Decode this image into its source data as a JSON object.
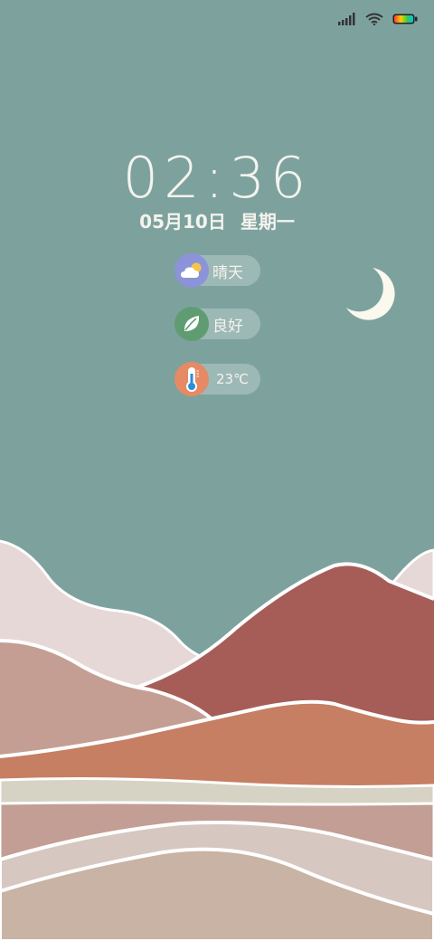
{
  "status_bar": {
    "icons": [
      "signal-icon",
      "wifi-icon",
      "battery-icon"
    ],
    "battery_colors": [
      "#ff3b30",
      "#ffcc00",
      "#34c759",
      "#00c7e6"
    ]
  },
  "lockscreen": {
    "time": "02:36",
    "date": "05月10日",
    "weekday": "星期一"
  },
  "widgets": [
    {
      "icon": "partly-cloudy-icon",
      "label": "晴天",
      "color": "#8c93d8"
    },
    {
      "icon": "leaf-icon",
      "label": "良好",
      "color": "#5f9c72"
    },
    {
      "icon": "thermometer-icon",
      "label": "23℃",
      "color": "#e58a64"
    }
  ],
  "wallpaper": {
    "moon_icon": "crescent-moon-icon",
    "colors": {
      "sky": "#7da29e",
      "pink_mountain": "#e6d8d7",
      "red_mountain": "#a65d58",
      "dusty_rose": "#c49e93",
      "orange_hill": "#c67f62",
      "cream_band": "#d6d3c4",
      "mauve_band": "#c29e95",
      "sand": "#c8b3a4"
    }
  }
}
